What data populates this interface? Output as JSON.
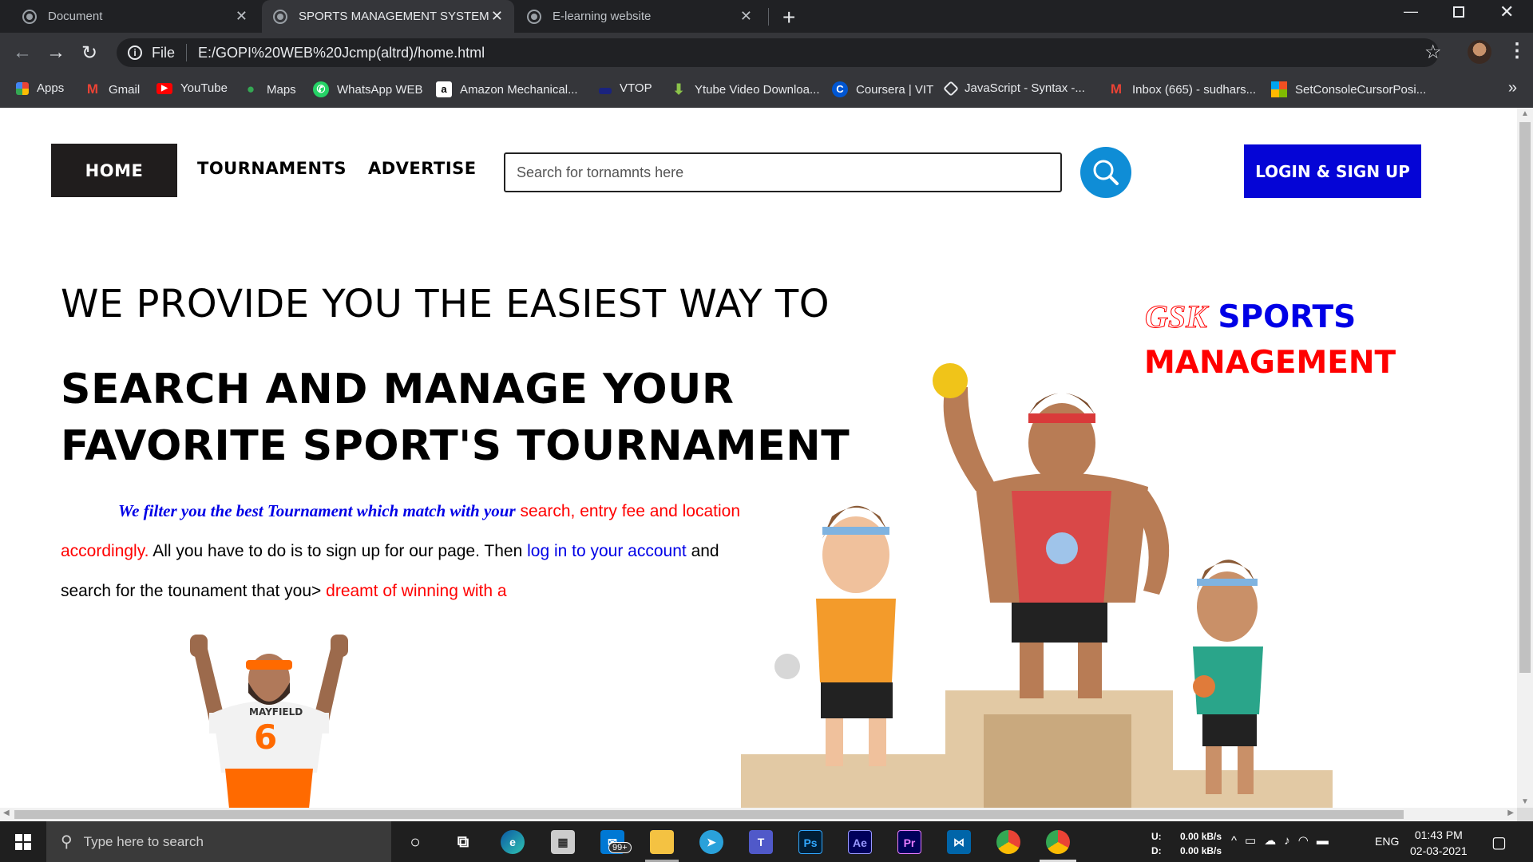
{
  "browser": {
    "tabs": [
      {
        "title": "Document",
        "active": false
      },
      {
        "title": "SPORTS MANAGEMENT SYSTEM",
        "active": true
      },
      {
        "title": "E-learning website",
        "active": false
      }
    ],
    "omnibox": {
      "scheme_label": "File",
      "url": "E:/GOPI%20WEB%20Jcmp(altrd)/home.html"
    },
    "bookmarks": [
      {
        "label": "Apps",
        "icon": "apps-grid-icon"
      },
      {
        "label": "Gmail",
        "icon": "gmail-icon"
      },
      {
        "label": "YouTube",
        "icon": "youtube-icon"
      },
      {
        "label": "Maps",
        "icon": "maps-icon"
      },
      {
        "label": "WhatsApp WEB",
        "icon": "whatsapp-icon"
      },
      {
        "label": "Amazon Mechanical...",
        "icon": "amazon-icon"
      },
      {
        "label": "VTOP",
        "icon": "vtop-icon"
      },
      {
        "label": "Ytube Video Downloa...",
        "icon": "download-icon"
      },
      {
        "label": "Coursera | VIT",
        "icon": "coursera-icon"
      },
      {
        "label": "JavaScript - Syntax -...",
        "icon": "javascript-icon"
      },
      {
        "label": "Inbox (665) - sudhars...",
        "icon": "gmail-icon"
      },
      {
        "label": "SetConsoleCursorPosi...",
        "icon": "microsoft-icon"
      }
    ]
  },
  "page": {
    "nav": {
      "home": "HOME",
      "tournaments": "TOURNAMENTS",
      "advertise": "ADVERTISE"
    },
    "search": {
      "placeholder": "Search for tornamnts here"
    },
    "login_label": "LOGIN & SIGN UP",
    "headline_line1": "WE PROVIDE YOU THE EASIEST WAY TO",
    "headline_line2": "SEARCH AND MANAGE YOUR",
    "headline_line3": "FAVORITE SPORT'S TOURNAMENT",
    "paragraph": {
      "p1": "We filter you the best Tournament which match with your",
      "p2": "search, entry fee and location accordingly.",
      "p3": "All you have to do is to sign up for our page. Then",
      "p4": "log in to your account",
      "p5": "and search for the tounament that you>",
      "p6": "dreamt of winning with a"
    },
    "brand": {
      "gsk": "GSK",
      "sports": "SPORTS",
      "management": "MANAGEMENT"
    },
    "player_jersey": {
      "name": "MAYFIELD",
      "number": "6"
    }
  },
  "taskbar": {
    "search_placeholder": "Type here to search",
    "mail_badge": "99+",
    "net_up_label": "U:",
    "net_down_label": "D:",
    "net_up": "0.00 kB/s",
    "net_down": "0.00 kB/s",
    "language": "ENG",
    "time": "01:43 PM",
    "date": "02-03-2021"
  },
  "colors": {
    "brand_blue": "#0000e6",
    "brand_red": "#ff0000",
    "search_button": "#0f8dd6",
    "login_button": "#0505d6",
    "home_button": "#201d1d"
  }
}
